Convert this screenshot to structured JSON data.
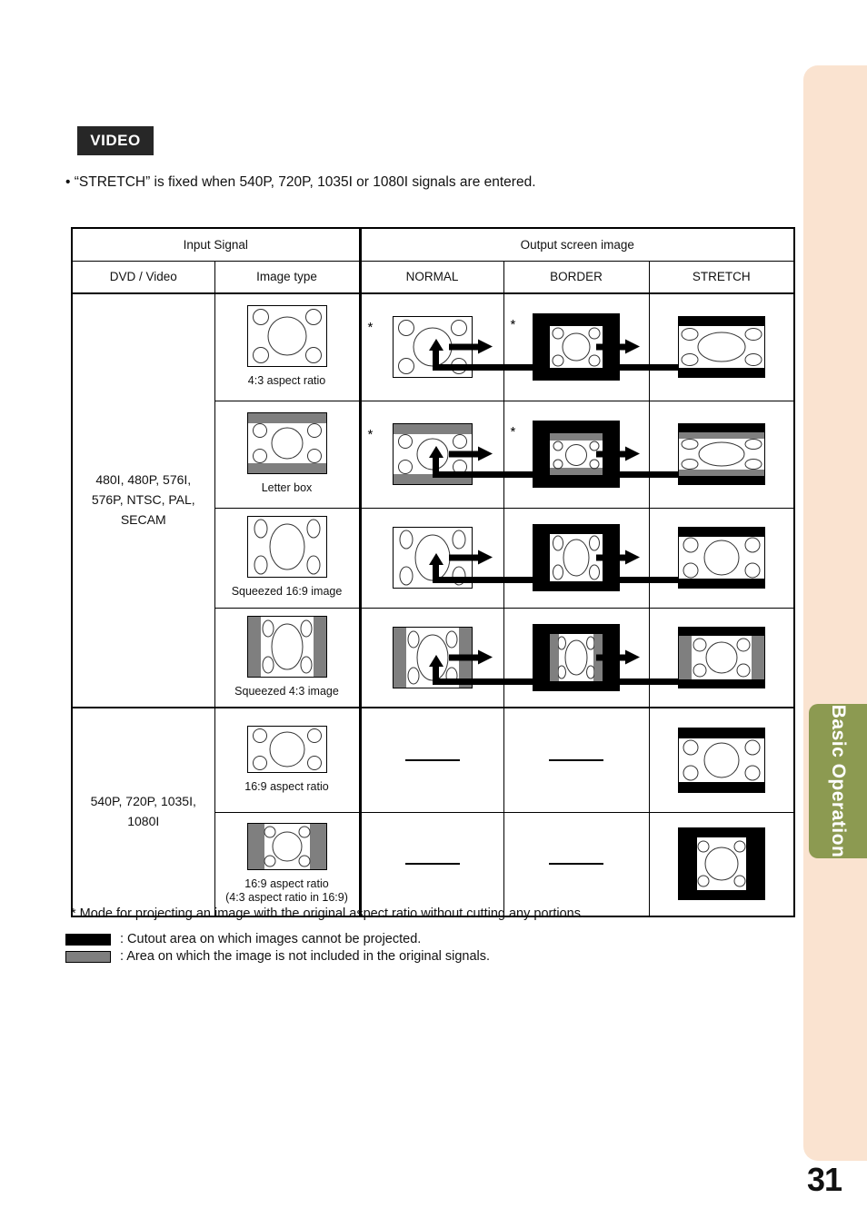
{
  "page": {
    "number": "31",
    "side_tab_label": "Basic Operation",
    "side_tab_color": "#8C9A51",
    "side_panel_color": "#FAE3D0"
  },
  "header": {
    "badge": "VIDEO",
    "note": "• “STRETCH” is fixed when 540P, 720P, 1035I or 1080I signals are entered."
  },
  "table": {
    "group_headers": {
      "input_signal": "Input Signal",
      "output_screen_image": "Output screen image"
    },
    "column_headers": {
      "dvd_video": "DVD / Video",
      "image_type": "Image type",
      "normal": "NORMAL",
      "border": "BORDER",
      "stretch": "STRETCH"
    },
    "groups": [
      {
        "signal_label": "480I, 480P, 576I,\n576P, NTSC, PAL,\nSECAM",
        "rows": [
          {
            "image_type_caption": "4:3 aspect ratio",
            "normal_star": "*",
            "border_star": "*",
            "stretch_star": "",
            "has_cycle": true
          },
          {
            "image_type_caption": "Letter box",
            "normal_star": "*",
            "border_star": "*",
            "stretch_star": "",
            "has_cycle": true
          },
          {
            "image_type_caption": "Squeezed 16:9 image",
            "normal_star": "",
            "border_star": "",
            "stretch_star": "*",
            "has_cycle": true
          },
          {
            "image_type_caption": "Squeezed 4:3 image",
            "normal_star": "",
            "border_star": "",
            "stretch_star": "*",
            "has_cycle": true
          }
        ]
      },
      {
        "signal_label": "540P, 720P, 1035I,\n1080I",
        "rows": [
          {
            "image_type_caption": "16:9 aspect ratio",
            "normal_star": "",
            "border_star": "",
            "stretch_star": "*",
            "has_cycle": false,
            "normal_empty": "—",
            "border_empty": "—"
          },
          {
            "image_type_caption": "16:9 aspect ratio\n(4:3 aspect ratio in 16:9)",
            "normal_star": "",
            "border_star": "",
            "stretch_star": "*",
            "has_cycle": false,
            "normal_empty": "—",
            "border_empty": "—"
          }
        ]
      }
    ]
  },
  "footnotes": {
    "star_note": "* Mode for projecting an image with the original aspect ratio without cutting any portions.",
    "legend": [
      {
        "swatch": "black",
        "text": ": Cutout area on which images cannot be projected."
      },
      {
        "swatch": "gray",
        "text": ": Area on which the image is not included in the original signals."
      }
    ]
  },
  "colors": {
    "cutout_black": "#000000",
    "not_included_gray": "#7F7F7F",
    "badge_bg": "#272727"
  }
}
